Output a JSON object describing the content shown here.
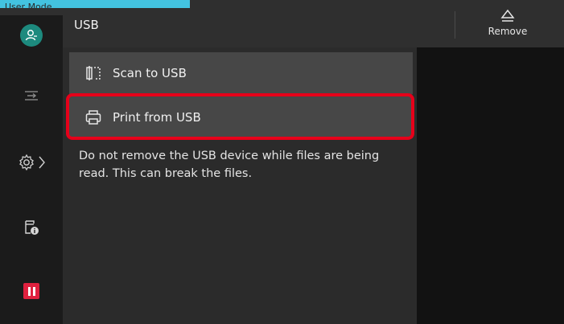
{
  "header": {
    "mode_label": "User Mode",
    "title": "USB",
    "remove_label": "Remove"
  },
  "rail": {
    "icons": [
      "user-icon",
      "job-transfer-icon",
      "gear-icon",
      "chevron-right-icon",
      "printer-info-icon",
      "pause-icon"
    ]
  },
  "menu": {
    "items": [
      {
        "label": "Scan to USB",
        "icon": "scan-icon"
      },
      {
        "label": "Print from USB",
        "icon": "printer-icon"
      }
    ]
  },
  "warning_text": "Do not remove the USB device while files are being read. This can break the files.",
  "colors": {
    "accent_tab": "#43c3e0",
    "highlight": "#e6001a",
    "user_avatar": "#1d8a7e",
    "pause": "#e0213f"
  }
}
